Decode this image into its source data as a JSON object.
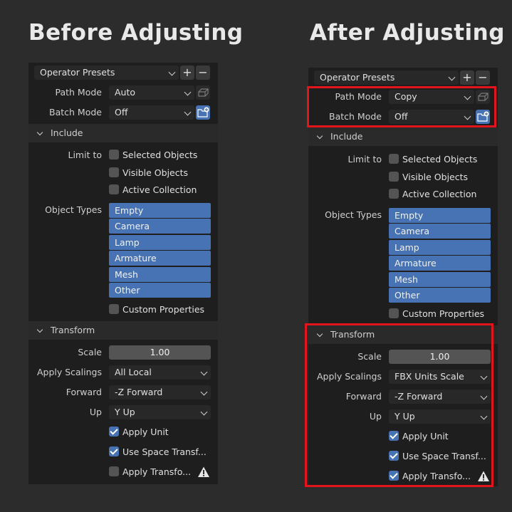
{
  "headings": {
    "before": "Before Adjusting",
    "after": "After Adjusting"
  },
  "before": {
    "presets": "Operator Presets",
    "plus": "+",
    "minus": "−",
    "path_mode": {
      "label": "Path Mode",
      "value": "Auto"
    },
    "batch_mode": {
      "label": "Batch Mode",
      "value": "Off"
    },
    "include": {
      "title": "Include",
      "limit_label": "Limit to",
      "checks": [
        "Selected Objects",
        "Visible Objects",
        "Active Collection"
      ],
      "types_label": "Object Types",
      "types": [
        "Empty",
        "Camera",
        "Lamp",
        "Armature",
        "Mesh",
        "Other"
      ],
      "custom": "Custom Properties"
    },
    "transform": {
      "title": "Transform",
      "scale_label": "Scale",
      "scale": "1.00",
      "apply_scalings_label": "Apply Scalings",
      "apply_scalings": "All Local",
      "forward_label": "Forward",
      "forward": "-Z Forward",
      "up_label": "Up",
      "up": "Y Up",
      "apply_unit": "Apply Unit",
      "use_space": "Use Space Transf...",
      "apply_transform": "Apply Transfo..."
    }
  },
  "after": {
    "presets": "Operator Presets",
    "plus": "+",
    "minus": "−",
    "path_mode": {
      "label": "Path Mode",
      "value": "Copy"
    },
    "batch_mode": {
      "label": "Batch Mode",
      "value": "Off"
    },
    "include": {
      "title": "Include",
      "limit_label": "Limit to",
      "checks": [
        "Selected Objects",
        "Visible Objects",
        "Active Collection"
      ],
      "types_label": "Object Types",
      "types": [
        "Empty",
        "Camera",
        "Lamp",
        "Armature",
        "Mesh",
        "Other"
      ],
      "custom": "Custom Properties"
    },
    "transform": {
      "title": "Transform",
      "scale_label": "Scale",
      "scale": "1.00",
      "apply_scalings_label": "Apply Scalings",
      "apply_scalings": "FBX Units Scale",
      "forward_label": "Forward",
      "forward": "-Z Forward",
      "up_label": "Up",
      "up": "Y Up",
      "apply_unit": "Apply Unit",
      "use_space": "Use Space Transf...",
      "apply_transform": "Apply Transfo..."
    }
  },
  "icons": {
    "path_mode": "pack-file-icon",
    "batch_mode": "new-folder-icon",
    "warning": "warning-icon"
  },
  "colors": {
    "accent": "#4772b3",
    "highlight": "#e3141b",
    "background": "#2c2c2c",
    "panel": "#1e1e1e"
  },
  "states": {
    "before": {
      "apply_unit": true,
      "use_space": true,
      "apply_transform": false
    },
    "after": {
      "apply_unit": true,
      "use_space": true,
      "apply_transform": true
    }
  }
}
